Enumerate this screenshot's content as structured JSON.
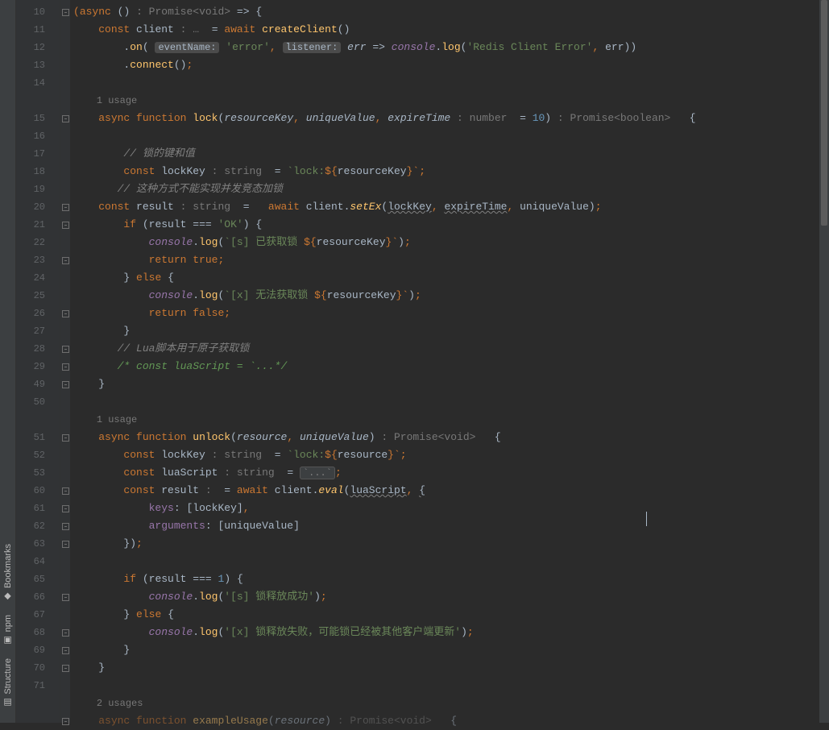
{
  "sidebar": {
    "bookmarks": "Bookmarks",
    "npm": "npm",
    "structure": "Structure"
  },
  "line_numbers": [
    "10",
    "11",
    "12",
    "13",
    "14",
    "",
    "15",
    "16",
    "17",
    "18",
    "19",
    "20",
    "21",
    "22",
    "23",
    "24",
    "25",
    "26",
    "27",
    "28",
    "29",
    "49",
    "50",
    "",
    "51",
    "52",
    "53",
    "60",
    "61",
    "62",
    "63",
    "64",
    "65",
    "66",
    "67",
    "68",
    "69",
    "70",
    "71",
    "",
    ""
  ],
  "usage1": "1 usage",
  "usage2": "1 usage",
  "usage3": "2 usages",
  "tokens": {
    "async": "async",
    "paren_o": "(",
    "paren_c": ")",
    "arrow": "=>",
    "brc_o": "{",
    "brc_c": "}",
    "type_promise_void": ": Promise<void>",
    "const": "const",
    "client": "client",
    "hint_dots": ": …",
    "eq": "=",
    "await": "await",
    "createClient": "createClient",
    "empty_call": "()",
    "dot": ".",
    "on": "on",
    "hint_eventName": "eventName:",
    "str_error": "'error'",
    "comma": ",",
    "hint_listener": "listener:",
    "err": "err",
    "console": "console",
    "log": "log",
    "str_redis": "'Redis Client Error'",
    "connect": "connect",
    "semi": ";",
    "function": "function",
    "lock": "lock",
    "resourceKey": "resourceKey",
    "uniqueValue": "uniqueValue",
    "expireTime": "expireTime",
    "hint_number": ": number",
    "eq10": "= ",
    "n10": "10",
    "type_promise_bool": ": Promise<boolean>",
    "cm17": "// 锁的键和值",
    "lockKey": "lockKey",
    "hint_string": ": string",
    "tpl_lock1_a": "`lock:",
    "tpl_lock1_b": "${",
    "tpl_lock1_c": "}`",
    "cm19": "// 这种方式不能实现并发竞态加锁",
    "result": "result",
    "setEx": "setEx",
    "if": "if",
    "triple_eq": "===",
    "str_OK": "'OK'",
    "tpl_s_a": "`[s] 已获取锁 ",
    "tpl_s_b": "${",
    "tpl_s_c": "}`",
    "return": "return",
    "true": "true",
    "else": "else",
    "tpl_x_a": "`[x] 无法获取锁 ",
    "tpl_x_b": "${",
    "tpl_x_c": "}`",
    "false": "false",
    "cm28": "// Lua脚本用于原子获取锁",
    "blk29": "/* const luaScript = `...*/",
    "unlock": "unlock",
    "resource": "resource",
    "tpl_lock2_a": "`lock:",
    "tpl_lock2_b": "${",
    "tpl_lock2_c": "}`",
    "luaScript": "luaScript",
    "fold_str": "`...`",
    "eval": "eval",
    "keys": "keys",
    "sqb_o": "[",
    "sqb_c": "]",
    "arguments": "arguments",
    "n1": "1",
    "str_rel_ok": "'[s] 锁释放成功'",
    "str_rel_fail": "'[x] 锁释放失败，可能锁已经被其他客户端更新'",
    "exampleUsage": "exampleUsage",
    "hint_colon": ":"
  }
}
